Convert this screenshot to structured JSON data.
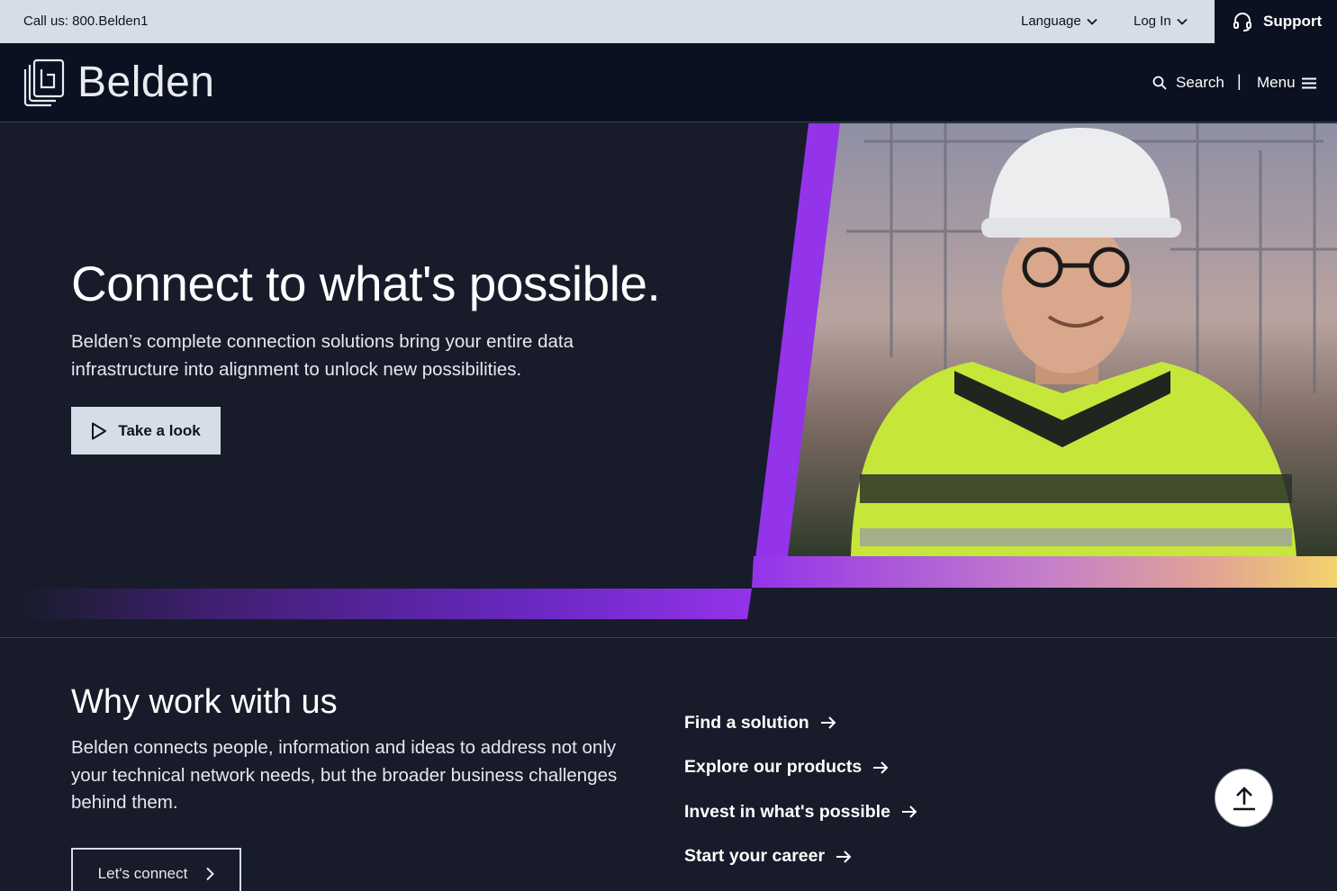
{
  "utility_bar": {
    "call_text": "Call us: 800.Belden1",
    "language_label": "Language",
    "login_label": "Log In",
    "support_label": "Support"
  },
  "header": {
    "logo_text": "Belden",
    "search_label": "Search",
    "separator": "|",
    "menu_label": "Menu"
  },
  "hero": {
    "title": "Connect to what's possible.",
    "description": "Belden’s complete connection solutions bring your entire data infrastructure into alignment to unlock new possibilities.",
    "cta_label": "Take a look",
    "accent_color": "#9333ea",
    "gradient_end_color": "#f3d36b"
  },
  "why": {
    "title": "Why work with us",
    "description": "Belden connects people, information and ideas to address not only your technical network needs, but the broader business challenges behind them.",
    "cta_label": "Let's connect",
    "links": [
      {
        "label": "Find a solution"
      },
      {
        "label": "Explore our products"
      },
      {
        "label": "Invest in what's possible"
      },
      {
        "label": "Start your career"
      }
    ]
  },
  "icons": {
    "support": "headset-icon",
    "search": "search-icon",
    "menu": "hamburger-icon",
    "play": "play-icon",
    "arrow": "arrow-right-icon",
    "back_to_top": "arrow-up-icon"
  }
}
